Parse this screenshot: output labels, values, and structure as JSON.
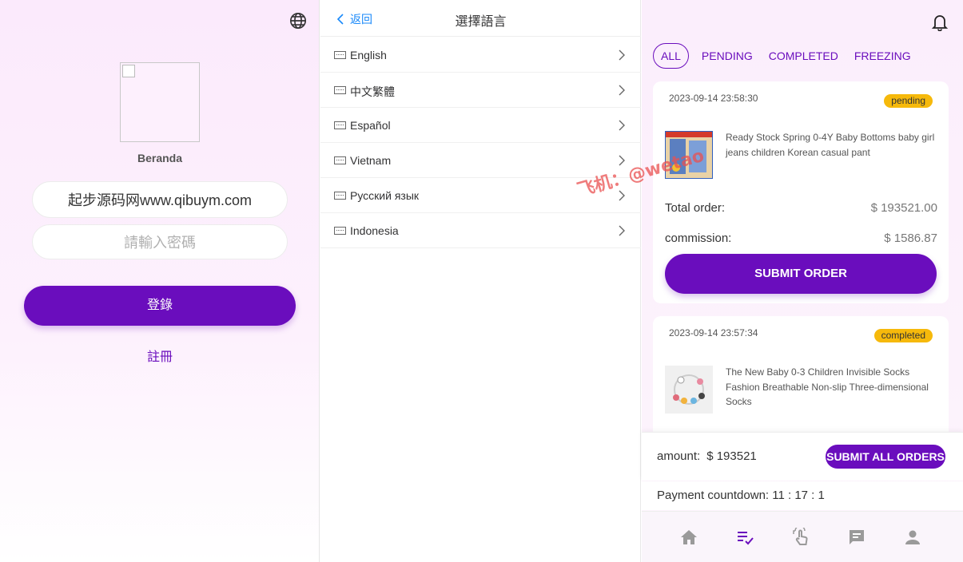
{
  "login": {
    "brand_name": "Beranda",
    "username_value": "起步源码网www.qibuym.com",
    "password_placeholder": "請輸入密碼",
    "login_label": "登錄",
    "register_label": "註冊",
    "icons": [
      "globe-icon",
      "broken-image-icon"
    ]
  },
  "language": {
    "back_label": "返回",
    "title": "選擇語言",
    "items": [
      {
        "label": "English"
      },
      {
        "label": "中文繁體"
      },
      {
        "label": "Español"
      },
      {
        "label": "Vietnam"
      },
      {
        "label": "Русский язык"
      },
      {
        "label": "Indonesia"
      }
    ]
  },
  "orders": {
    "tabs": [
      {
        "label": "ALL",
        "active": true
      },
      {
        "label": "PENDING",
        "active": false
      },
      {
        "label": "COMPLETED",
        "active": false
      },
      {
        "label": "FREEZING",
        "active": false
      }
    ],
    "cards": [
      {
        "date": "2023-09-14 23:58:30",
        "status": "pending",
        "product": "Ready Stock Spring 0-4Y Baby Bottoms baby girl jeans children Korean casual pant",
        "total_label": "Total order:",
        "total_value": "$ 193521.00",
        "commission_label": "commission:",
        "commission_value": "$ 1586.87",
        "submit_label": "SUBMIT ORDER"
      },
      {
        "date": "2023-09-14 23:57:34",
        "status": "completed",
        "product": "The New Baby 0-3 Children Invisible Socks Fashion Breathable Non-slip Three-dimensional Socks"
      }
    ],
    "amount_label": "amount:",
    "amount_value": "$ 193521",
    "submit_all_label": "SUBMIT ALL ORDERS",
    "countdown": "Payment countdown: 11 : 17 : 1",
    "tabbar": [
      "home-icon",
      "orders-icon",
      "tap-icon",
      "message-icon",
      "user-icon"
    ],
    "accent": "#6a0dbd",
    "badge_color": "#f6b90b"
  },
  "watermark": "飞机：@wetao"
}
